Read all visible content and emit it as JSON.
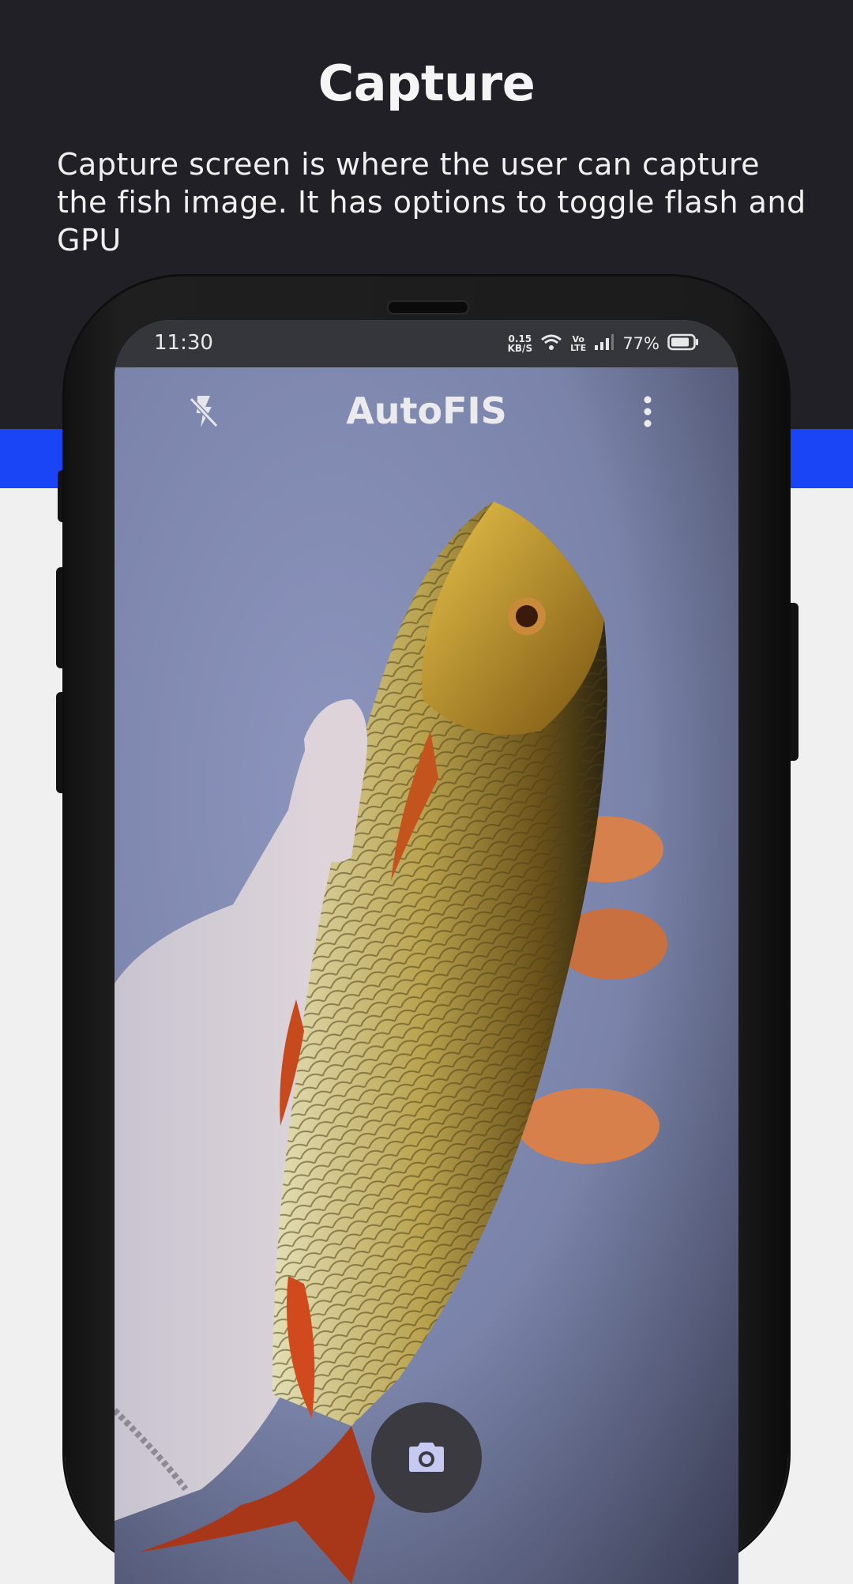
{
  "promo": {
    "title": "Capture",
    "description": "Capture screen is where the user can capture the fish image. It has options to toggle flash and GPU"
  },
  "status_bar": {
    "time": "11:30",
    "net_speed_value": "0.15",
    "net_speed_unit": "KB/S",
    "volte_top": "Vo",
    "volte_bottom": "LTE",
    "battery": "77%",
    "icons": [
      "wifi-icon",
      "signal-icon",
      "battery-icon"
    ]
  },
  "app": {
    "title": "AutoFIS",
    "flash_icon": "flash-off-icon",
    "menu_icon": "more-vert-icon",
    "capture_icon": "camera-icon"
  },
  "colors": {
    "header_bg": "#202026",
    "accent_blue": "#1a45f6",
    "capture_icon": "#c6caf2"
  }
}
